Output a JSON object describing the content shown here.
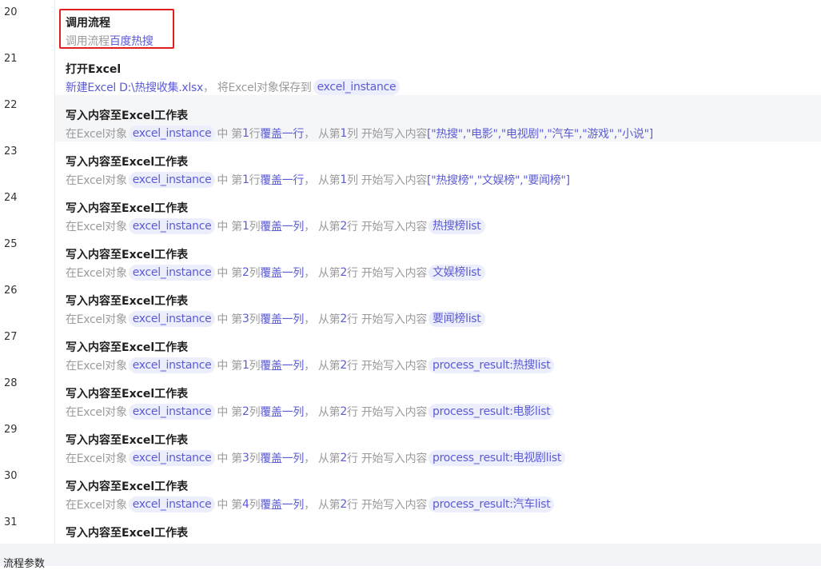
{
  "line_numbers": [
    "20",
    "21",
    "22",
    "23",
    "24",
    "25",
    "26",
    "27",
    "28",
    "29",
    "30",
    "31"
  ],
  "steps": [
    {
      "title": "调用流程",
      "parts": [
        {
          "t": "k",
          "v": "调用流程 "
        },
        {
          "t": "v",
          "v": "百度热搜"
        }
      ]
    },
    {
      "title": "打开Excel",
      "parts": [
        {
          "t": "v",
          "v": "新建Excel D:\\热搜收集.xlsx"
        },
        {
          "t": "k",
          "v": "， 将Excel对象保存到"
        },
        {
          "t": "p",
          "v": "excel_instance"
        }
      ]
    },
    {
      "title": "写入内容至Excel工作表",
      "parts": [
        {
          "t": "k",
          "v": "在Excel对象"
        },
        {
          "t": "p",
          "v": "excel_instance"
        },
        {
          "t": "k",
          "v": "中 第"
        },
        {
          "t": "v",
          "v": "1"
        },
        {
          "t": "k",
          "v": "行"
        },
        {
          "t": "v",
          "v": "覆盖一行"
        },
        {
          "t": "k",
          "v": "， 从第"
        },
        {
          "t": "v",
          "v": "1"
        },
        {
          "t": "k",
          "v": "列 开始写入内容"
        },
        {
          "t": "v",
          "v": "[\"热搜\",\"电影\",\"电视剧\",\"汽车\",\"游戏\",\"小说\"]"
        }
      ]
    },
    {
      "title": "写入内容至Excel工作表",
      "parts": [
        {
          "t": "k",
          "v": "在Excel对象"
        },
        {
          "t": "p",
          "v": "excel_instance"
        },
        {
          "t": "k",
          "v": "中 第"
        },
        {
          "t": "v",
          "v": "1"
        },
        {
          "t": "k",
          "v": "行"
        },
        {
          "t": "v",
          "v": "覆盖一行"
        },
        {
          "t": "k",
          "v": "， 从第"
        },
        {
          "t": "v",
          "v": "1"
        },
        {
          "t": "k",
          "v": "列 开始写入内容"
        },
        {
          "t": "v",
          "v": "[\"热搜榜\",\"文娱榜\",\"要闻榜\"]"
        }
      ]
    },
    {
      "title": "写入内容至Excel工作表",
      "parts": [
        {
          "t": "k",
          "v": "在Excel对象"
        },
        {
          "t": "p",
          "v": "excel_instance"
        },
        {
          "t": "k",
          "v": "中 第"
        },
        {
          "t": "v",
          "v": "1"
        },
        {
          "t": "k",
          "v": "列"
        },
        {
          "t": "v",
          "v": "覆盖一列"
        },
        {
          "t": "k",
          "v": "， 从第"
        },
        {
          "t": "v",
          "v": "2"
        },
        {
          "t": "k",
          "v": "行 开始写入内容"
        },
        {
          "t": "p",
          "v": "热搜榜list"
        }
      ]
    },
    {
      "title": "写入内容至Excel工作表",
      "parts": [
        {
          "t": "k",
          "v": "在Excel对象"
        },
        {
          "t": "p",
          "v": "excel_instance"
        },
        {
          "t": "k",
          "v": "中 第"
        },
        {
          "t": "v",
          "v": "2"
        },
        {
          "t": "k",
          "v": "列"
        },
        {
          "t": "v",
          "v": "覆盖一列"
        },
        {
          "t": "k",
          "v": "， 从第"
        },
        {
          "t": "v",
          "v": "2"
        },
        {
          "t": "k",
          "v": "行 开始写入内容"
        },
        {
          "t": "p",
          "v": "文娱榜list"
        }
      ]
    },
    {
      "title": "写入内容至Excel工作表",
      "parts": [
        {
          "t": "k",
          "v": "在Excel对象"
        },
        {
          "t": "p",
          "v": "excel_instance"
        },
        {
          "t": "k",
          "v": "中 第"
        },
        {
          "t": "v",
          "v": "3"
        },
        {
          "t": "k",
          "v": "列"
        },
        {
          "t": "v",
          "v": "覆盖一列"
        },
        {
          "t": "k",
          "v": "， 从第"
        },
        {
          "t": "v",
          "v": "2"
        },
        {
          "t": "k",
          "v": "行 开始写入内容"
        },
        {
          "t": "p",
          "v": "要闻榜list"
        }
      ]
    },
    {
      "title": "写入内容至Excel工作表",
      "parts": [
        {
          "t": "k",
          "v": "在Excel对象"
        },
        {
          "t": "p",
          "v": "excel_instance"
        },
        {
          "t": "k",
          "v": "中 第"
        },
        {
          "t": "v",
          "v": "1"
        },
        {
          "t": "k",
          "v": "列"
        },
        {
          "t": "v",
          "v": "覆盖一列"
        },
        {
          "t": "k",
          "v": "， 从第"
        },
        {
          "t": "v",
          "v": "2"
        },
        {
          "t": "k",
          "v": "行 开始写入内容"
        },
        {
          "t": "p",
          "v": "process_result:热搜list"
        }
      ]
    },
    {
      "title": "写入内容至Excel工作表",
      "parts": [
        {
          "t": "k",
          "v": "在Excel对象"
        },
        {
          "t": "p",
          "v": "excel_instance"
        },
        {
          "t": "k",
          "v": "中 第"
        },
        {
          "t": "v",
          "v": "2"
        },
        {
          "t": "k",
          "v": "列"
        },
        {
          "t": "v",
          "v": "覆盖一列"
        },
        {
          "t": "k",
          "v": "， 从第"
        },
        {
          "t": "v",
          "v": "2"
        },
        {
          "t": "k",
          "v": "行 开始写入内容"
        },
        {
          "t": "p",
          "v": "process_result:电影list"
        }
      ]
    },
    {
      "title": "写入内容至Excel工作表",
      "parts": [
        {
          "t": "k",
          "v": "在Excel对象"
        },
        {
          "t": "p",
          "v": "excel_instance"
        },
        {
          "t": "k",
          "v": "中 第"
        },
        {
          "t": "v",
          "v": "3"
        },
        {
          "t": "k",
          "v": "列"
        },
        {
          "t": "v",
          "v": "覆盖一列"
        },
        {
          "t": "k",
          "v": "， 从第"
        },
        {
          "t": "v",
          "v": "2"
        },
        {
          "t": "k",
          "v": "行 开始写入内容"
        },
        {
          "t": "p",
          "v": "process_result:电视剧list"
        }
      ]
    },
    {
      "title": "写入内容至Excel工作表",
      "parts": [
        {
          "t": "k",
          "v": "在Excel对象"
        },
        {
          "t": "p",
          "v": "excel_instance"
        },
        {
          "t": "k",
          "v": "中 第"
        },
        {
          "t": "v",
          "v": "4"
        },
        {
          "t": "k",
          "v": "列"
        },
        {
          "t": "v",
          "v": "覆盖一列"
        },
        {
          "t": "k",
          "v": "， 从第"
        },
        {
          "t": "v",
          "v": "2"
        },
        {
          "t": "k",
          "v": "行 开始写入内容"
        },
        {
          "t": "p",
          "v": "process_result:汽车list"
        }
      ]
    },
    {
      "title": "写入内容至Excel工作表",
      "parts": []
    }
  ],
  "bottom_panel_label": "流程参数"
}
